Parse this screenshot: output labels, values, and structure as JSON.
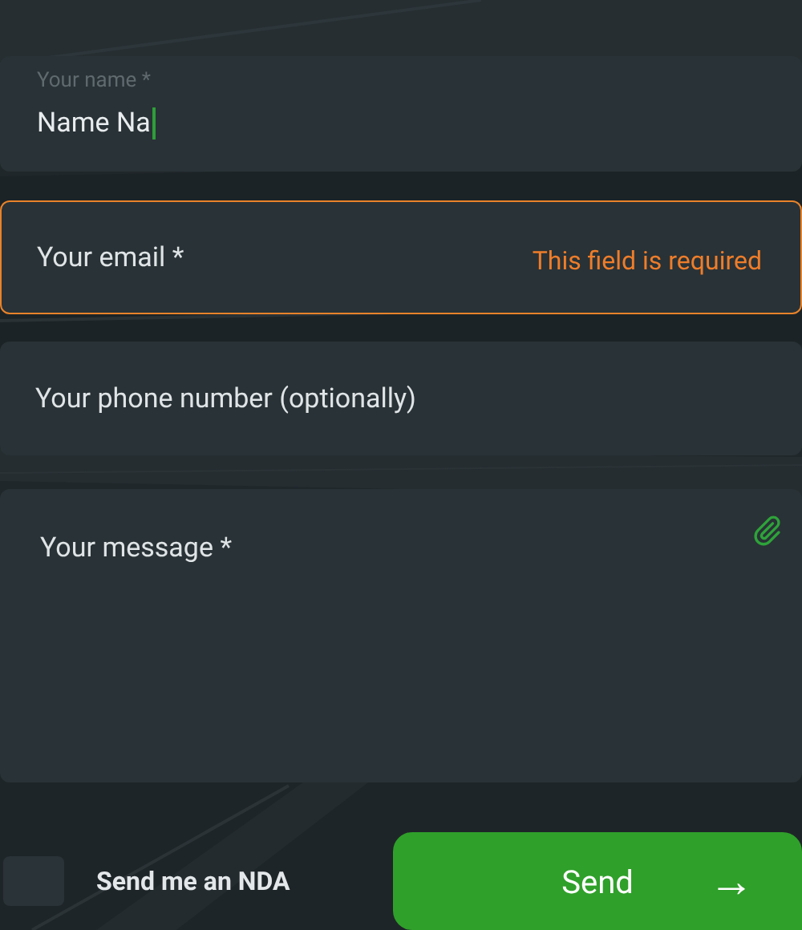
{
  "fields": [
    {
      "kind": "filled",
      "label": "Your name *",
      "value": "Name Na",
      "focused": true
    },
    {
      "kind": "error",
      "placeholder": "Your email *",
      "error": "This field is required"
    },
    {
      "kind": "plain",
      "placeholder": "Your phone number (optionally)"
    },
    {
      "kind": "textarea",
      "placeholder": "Your message *"
    }
  ],
  "nda": {
    "label": "Send me an NDA",
    "checked": false
  },
  "send": {
    "label": "Send",
    "arrow": "→"
  }
}
